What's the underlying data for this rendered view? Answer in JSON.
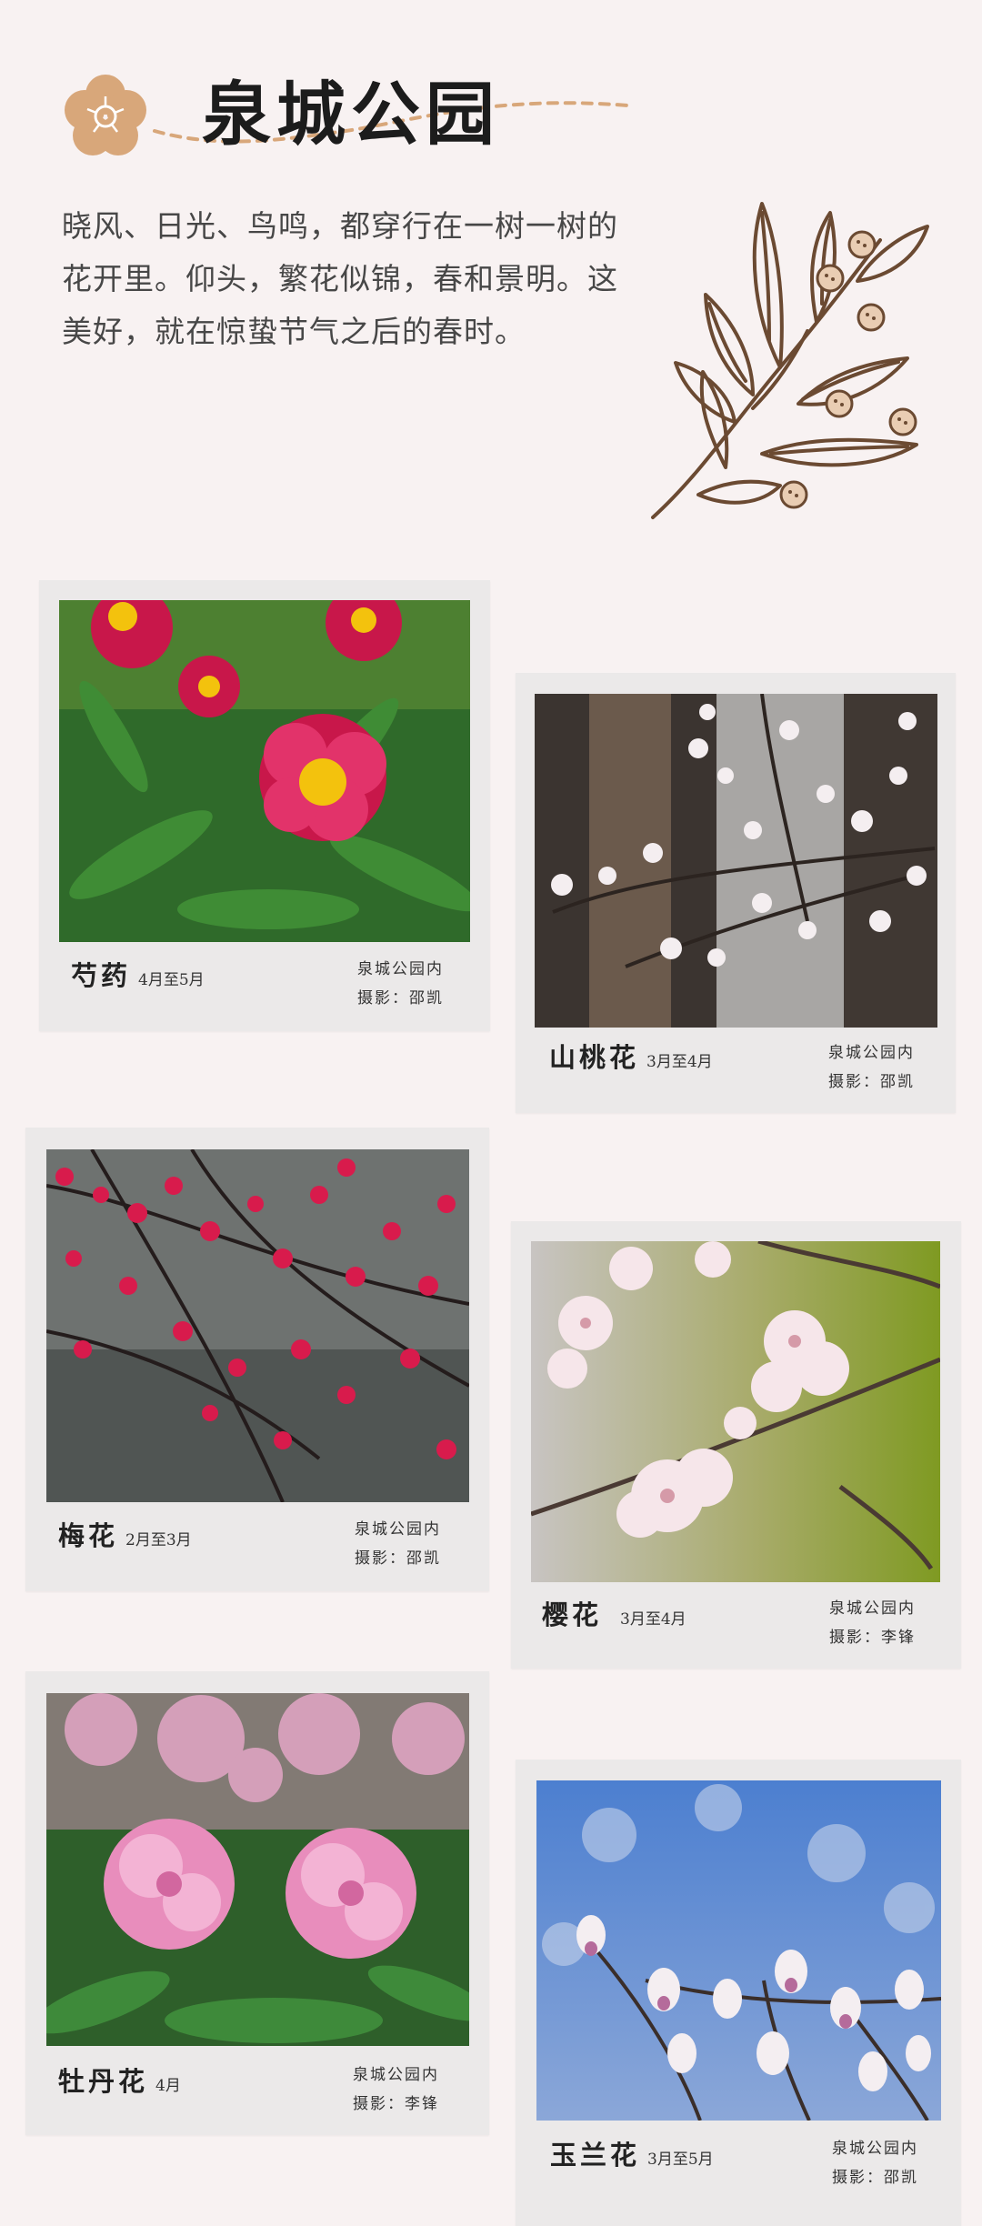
{
  "header": {
    "title": "泉城公园",
    "icon": "flower-icon"
  },
  "intro": {
    "text": "晓风、日光、鸟鸣，都穿行在一树一树的花开里。仰头，繁花似锦，春和景明。这美好，就在惊蛰节气之后的春时。"
  },
  "decor": {
    "branch_icon": "leaf-branch-icon"
  },
  "colors": {
    "background": "#f8f2f2",
    "card": "#ebe9e9",
    "accent": "#d8a77a",
    "line": "#6b4a32"
  },
  "cards": [
    {
      "name": "芍药",
      "date": "4月至5月",
      "location": "泉城公园内",
      "photographer": "摄影：邵凯"
    },
    {
      "name": "山桃花",
      "date": "3月至4月",
      "location": "泉城公园内",
      "photographer": "摄影：邵凯"
    },
    {
      "name": "梅花",
      "date": "2月至3月",
      "location": "泉城公园内",
      "photographer": "摄影：邵凯"
    },
    {
      "name": "樱花",
      "date": "3月至4月",
      "location": "泉城公园内",
      "photographer": "摄影：李锋"
    },
    {
      "name": "牡丹花",
      "date": "4月",
      "location": "泉城公园内",
      "photographer": "摄影：李锋"
    },
    {
      "name": "玉兰花",
      "date": "3月至5月",
      "location": "泉城公园内",
      "photographer": "摄影：邵凯"
    }
  ]
}
